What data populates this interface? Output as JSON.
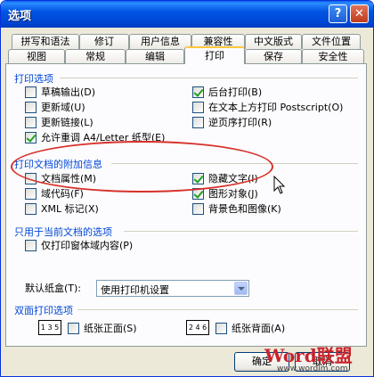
{
  "window": {
    "title": "选项",
    "help_label": "?",
    "close_label": "✕"
  },
  "tabs_row1": [
    {
      "label": "拼写和语法"
    },
    {
      "label": "修订"
    },
    {
      "label": "用户信息"
    },
    {
      "label": "兼容性"
    },
    {
      "label": "中文版式"
    },
    {
      "label": "文件位置"
    }
  ],
  "tabs_row2": [
    {
      "label": "视图"
    },
    {
      "label": "常规"
    },
    {
      "label": "编辑"
    },
    {
      "label": "打印",
      "active": true
    },
    {
      "label": "保存"
    },
    {
      "label": "安全性"
    }
  ],
  "print_options": {
    "title": "打印选项",
    "left": [
      {
        "label": "草稿输出(D)",
        "checked": false
      },
      {
        "label": "更新域(U)",
        "checked": false
      },
      {
        "label": "更新链接(L)",
        "checked": false
      },
      {
        "label": "允许重调 A4/Letter 纸型(E)",
        "checked": true
      }
    ],
    "right": [
      {
        "label": "后台打印(B)",
        "checked": true
      },
      {
        "label": "在文本上方打印 Postscript(O)",
        "checked": false
      },
      {
        "label": "逆页序打印(R)",
        "checked": false
      }
    ]
  },
  "document_info": {
    "title": "打印文档的附加信息",
    "left": [
      {
        "label": "文档属性(M)",
        "checked": false
      },
      {
        "label": "域代码(F)",
        "checked": false
      },
      {
        "label": "XML 标记(X)",
        "checked": false
      }
    ],
    "right": [
      {
        "label": "隐藏文字(I)",
        "checked": true
      },
      {
        "label": "图形对象(J)",
        "checked": true
      },
      {
        "label": "背景色和图像(K)",
        "checked": false
      }
    ]
  },
  "current_doc": {
    "title": "只用于当前文档的选项",
    "form_data": {
      "label": "仅打印窗体域内容(P)",
      "checked": false
    }
  },
  "tray": {
    "label": "默认纸盒(T):",
    "value": "使用打印机设置"
  },
  "duplex": {
    "title": "双面打印选项",
    "front": {
      "label": "纸张正面(S)",
      "checked": false,
      "icon_text": "1 3 5"
    },
    "back": {
      "label": "纸张背面(A)",
      "checked": false,
      "icon_text": "2 4 6"
    }
  },
  "buttons": {
    "ok": "确定",
    "cancel": "取消"
  },
  "watermark": {
    "main": "Word联盟",
    "sub": "www.wordlm.com"
  },
  "colors": {
    "titlebar": "#0054e3",
    "section_title": "#0046d5",
    "highlight": "#d7312a",
    "check": "#21a121"
  }
}
